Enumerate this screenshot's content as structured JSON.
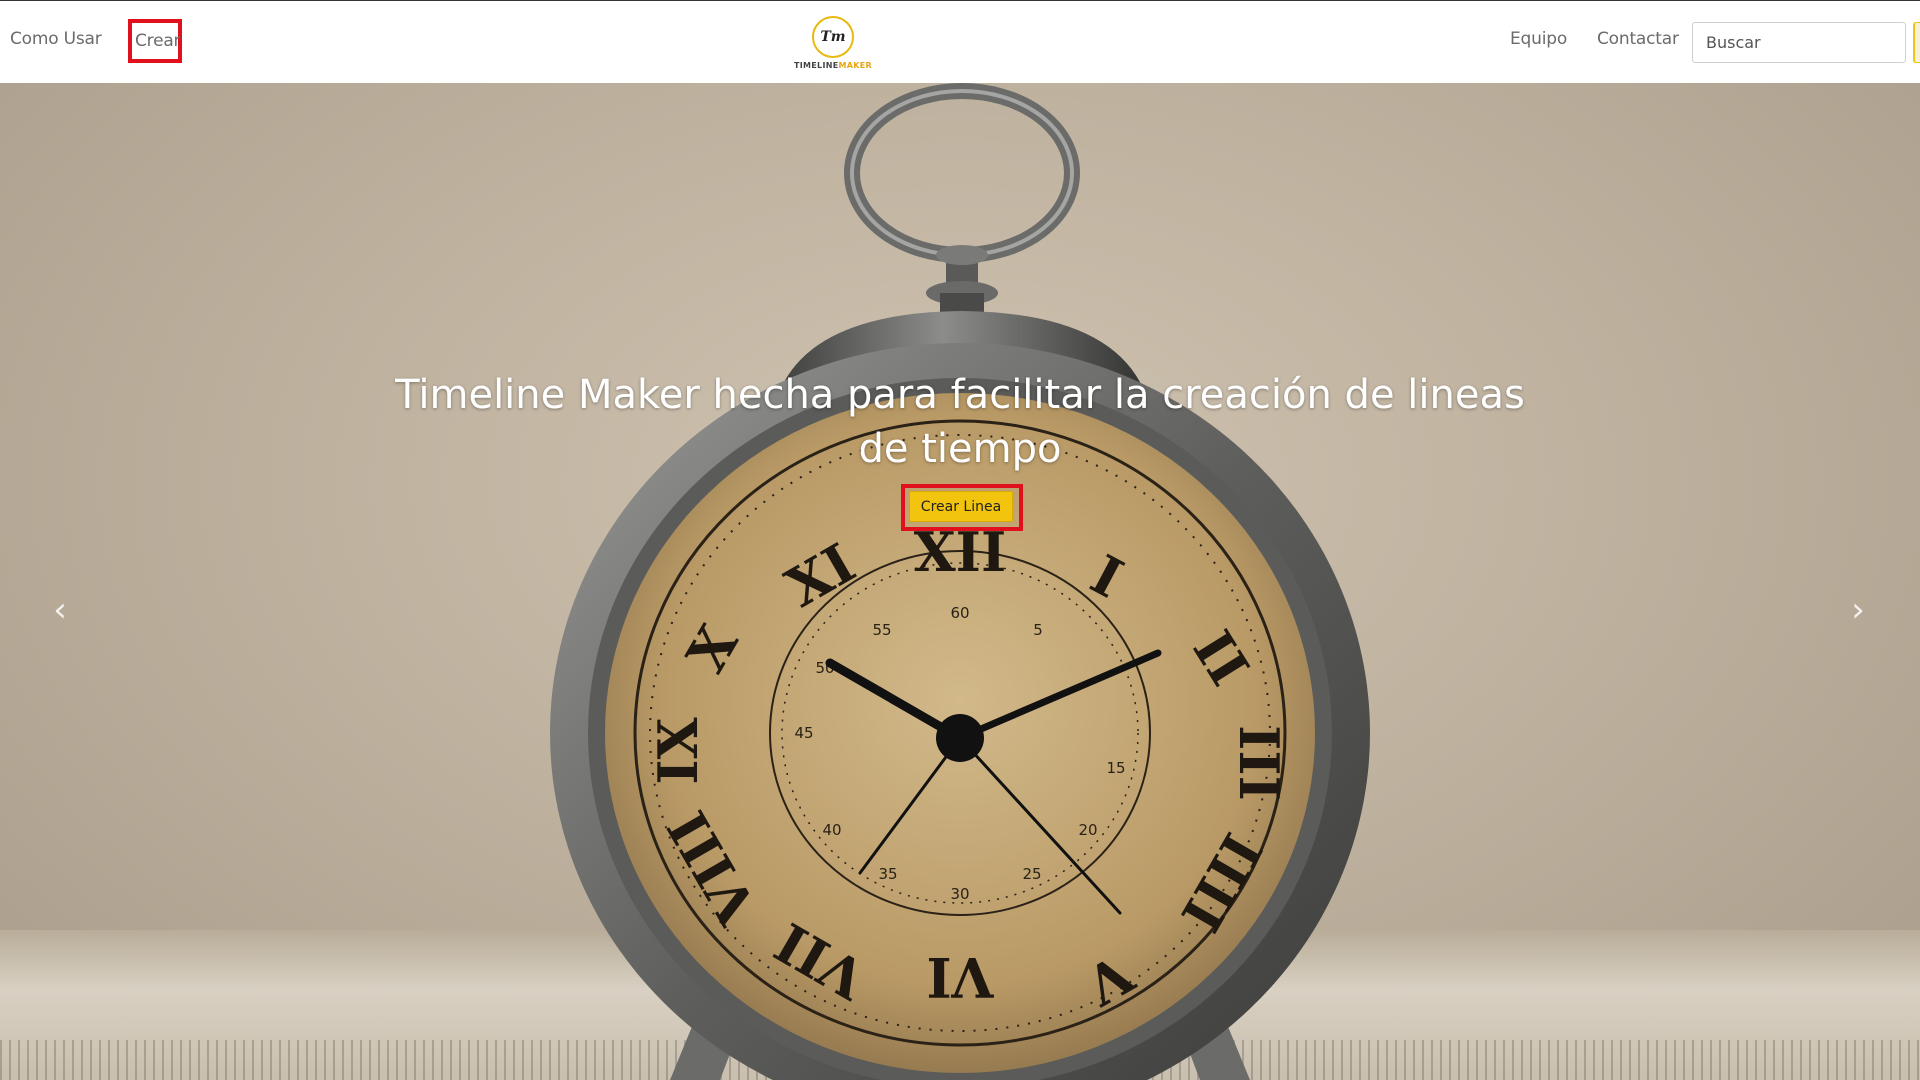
{
  "nav": {
    "links": [
      "Como Usar",
      "Crear",
      "Equipo",
      "Contactar"
    ],
    "logo": {
      "monogram": "Tm",
      "text_primary": "TIMELINE",
      "text_accent": "MAKER"
    },
    "search": {
      "placeholder": "Buscar"
    }
  },
  "hero": {
    "title": "Timeline Maker hecha para facilitar la creación de lineas de tiempo",
    "cta_label": "Crear Linea",
    "prev_icon": "chevron-left-icon",
    "next_icon": "chevron-right-icon"
  },
  "clock": {
    "roman_numerals": [
      "XII",
      "I",
      "II",
      "III",
      "IIII",
      "V",
      "VI",
      "VII",
      "VIII",
      "IX",
      "X",
      "XI"
    ],
    "minute_labels": [
      "60",
      "5",
      "15",
      "20",
      "25",
      "30",
      "35",
      "40",
      "45",
      "50",
      "55"
    ]
  },
  "colors": {
    "accent": "#f2c40e",
    "highlight": "#e0101c"
  }
}
